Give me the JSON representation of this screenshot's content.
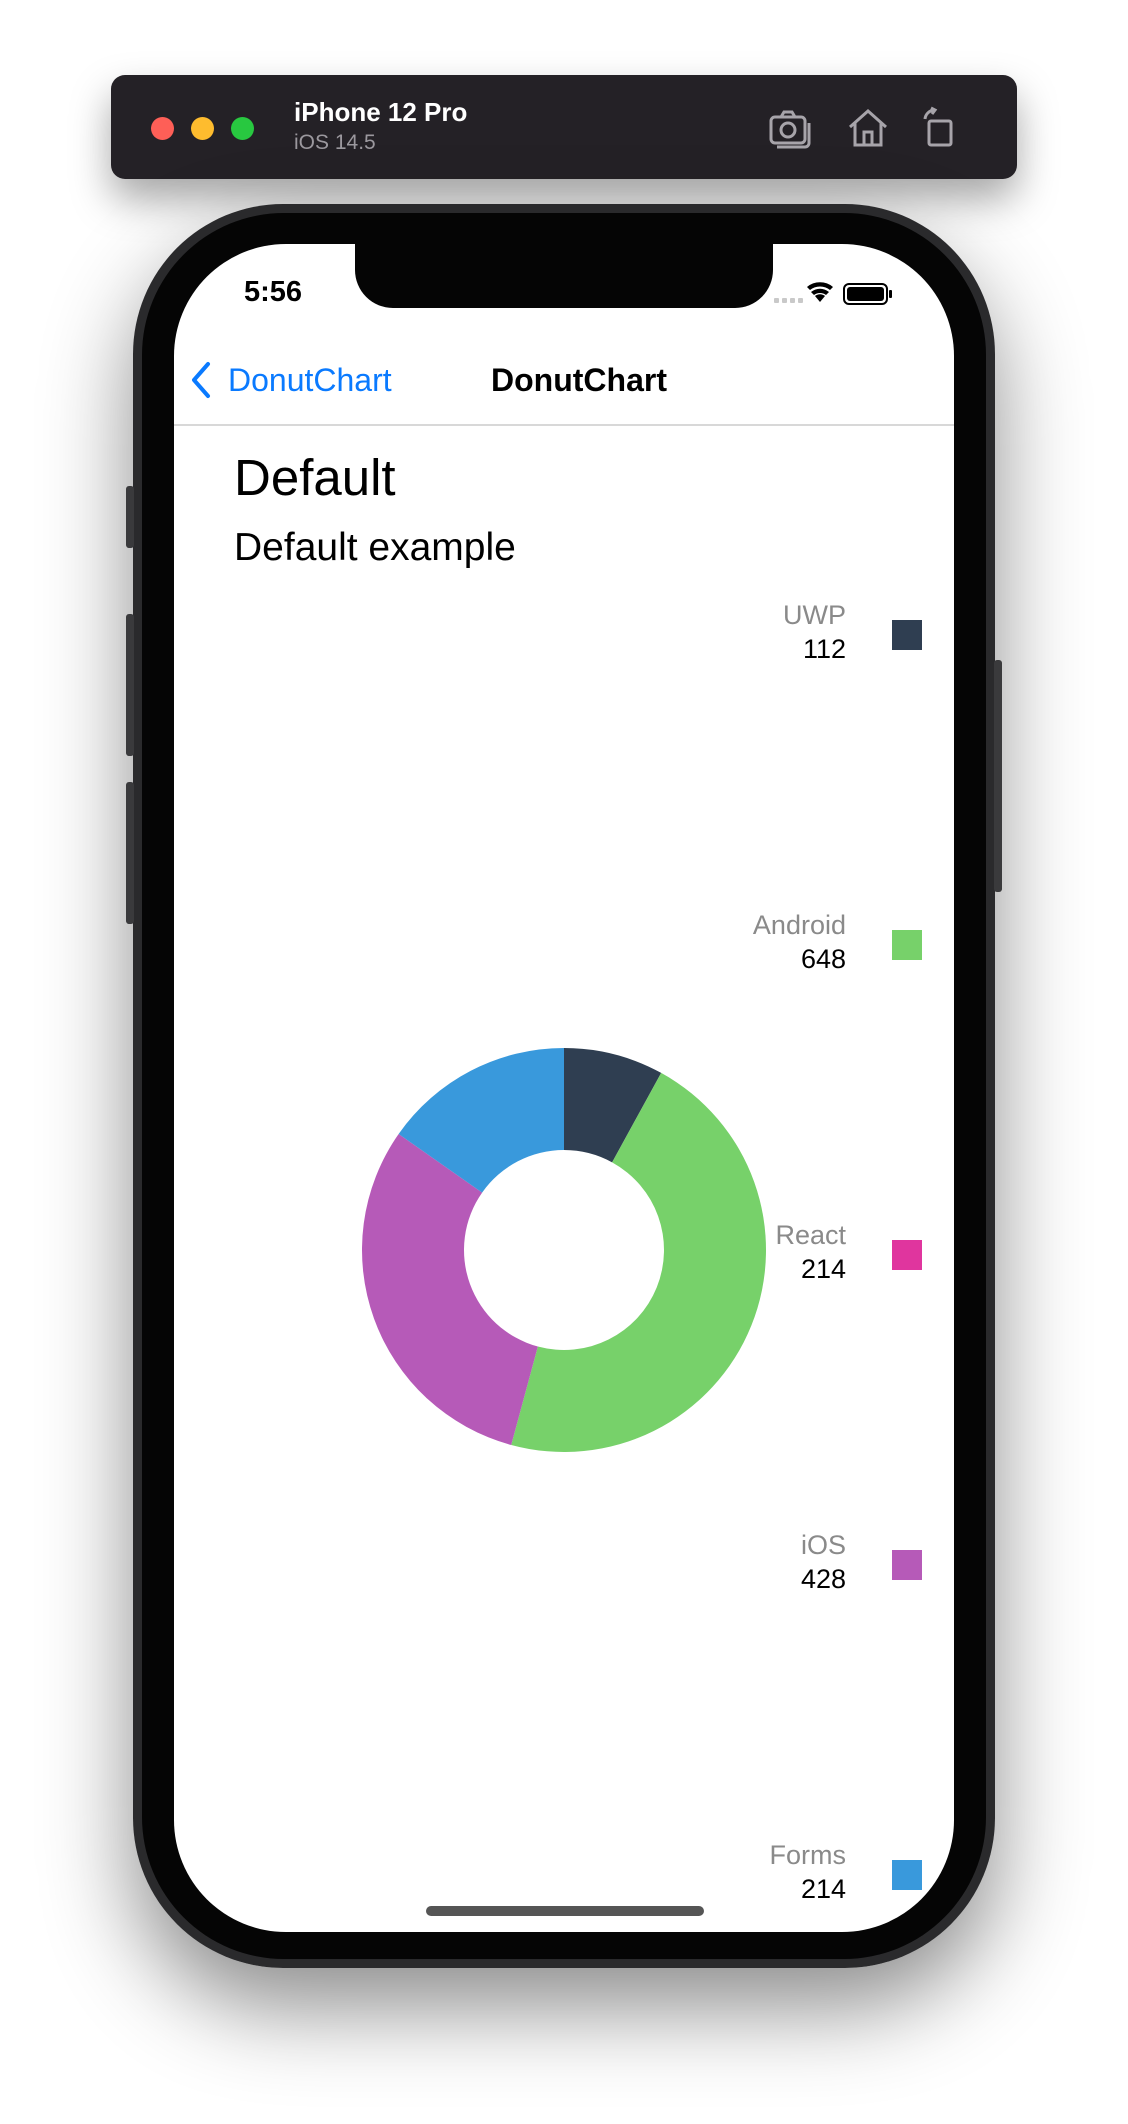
{
  "simulator": {
    "device_name": "iPhone 12 Pro",
    "os_version": "iOS 14.5",
    "tools": [
      "screenshot-icon",
      "home-icon",
      "rotate-icon"
    ]
  },
  "status_bar": {
    "time": "5:56"
  },
  "nav": {
    "back_label": "DonutChart",
    "title": "DonutChart"
  },
  "page": {
    "title": "Default",
    "subtitle": "Default example"
  },
  "colors": {
    "accent": "#0a7aff",
    "uwp": "#2f3e51",
    "android": "#77d16a",
    "react": "#e0359e",
    "ios": "#b65ab8",
    "forms": "#3999dc"
  },
  "chart_data": {
    "type": "pie",
    "donut": true,
    "categories": [
      "UWP",
      "Android",
      "React",
      "iOS",
      "Forms"
    ],
    "values": [
      112,
      648,
      214,
      428,
      214
    ],
    "legend_placement": "right"
  },
  "legend": [
    {
      "label": "UWP",
      "value": "112",
      "color": "#2f3e51"
    },
    {
      "label": "Android",
      "value": "648",
      "color": "#77d16a"
    },
    {
      "label": "React",
      "value": "214",
      "color": "#e0359e"
    },
    {
      "label": "iOS",
      "value": "428",
      "color": "#b65ab8"
    },
    {
      "label": "Forms",
      "value": "214",
      "color": "#3999dc"
    }
  ]
}
